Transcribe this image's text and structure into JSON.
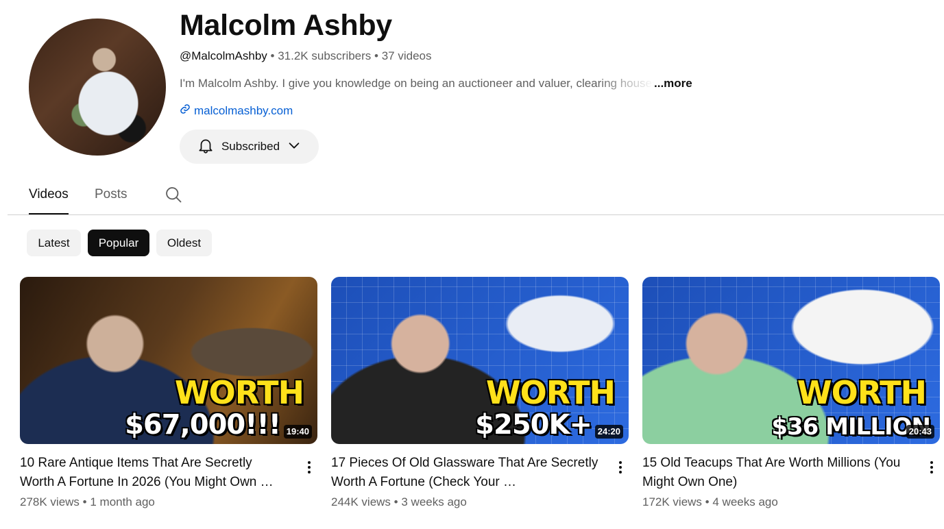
{
  "channel": {
    "name": "Malcolm Ashby",
    "handle": "@MalcolmAshby",
    "subscribers": "31.2K subscribers",
    "videos": "37 videos",
    "separator": "•",
    "description": "I'm Malcolm Ashby. I give you knowledge on being an auctioneer and valuer, clearing houses",
    "more_label": "...more",
    "link": "malcolmashby.com",
    "subscribe_label": "Subscribed"
  },
  "tabs": [
    {
      "label": "Videos",
      "active": true
    },
    {
      "label": "Posts",
      "active": false
    }
  ],
  "chips": [
    {
      "label": "Latest",
      "active": false
    },
    {
      "label": "Popular",
      "active": true
    },
    {
      "label": "Oldest",
      "active": false
    }
  ],
  "videos": [
    {
      "title": "10 Rare Antique Items That Are Secretly Worth A Fortune In 2026 (You Might Own …",
      "views": "278K views",
      "age": "1 month ago",
      "duration": "19:40",
      "overlay_line1": "WORTH",
      "overlay_line2": "$67,000!!!"
    },
    {
      "title": "17 Pieces Of Old Glassware That Are Secretly Worth A Fortune (Check Your …",
      "views": "244K views",
      "age": "3 weeks ago",
      "duration": "24:20",
      "overlay_line1": "WORTH",
      "overlay_line2": "$250K+"
    },
    {
      "title": "15 Old Teacups That Are Worth Millions (You Might Own One)",
      "views": "172K views",
      "age": "4 weeks ago",
      "duration": "20:43",
      "overlay_line1": "WORTH",
      "overlay_line2": "$36 MILLION"
    }
  ],
  "colors": {
    "link": "#065fd4",
    "text_secondary": "#606060",
    "chip_bg": "#f2f2f2",
    "chip_active_bg": "#0f0f0f",
    "overlay_yellow": "#ffe11a"
  },
  "icons": [
    "link-icon",
    "bell-icon",
    "chevron-down-icon",
    "search-icon",
    "more-vert-icon"
  ]
}
